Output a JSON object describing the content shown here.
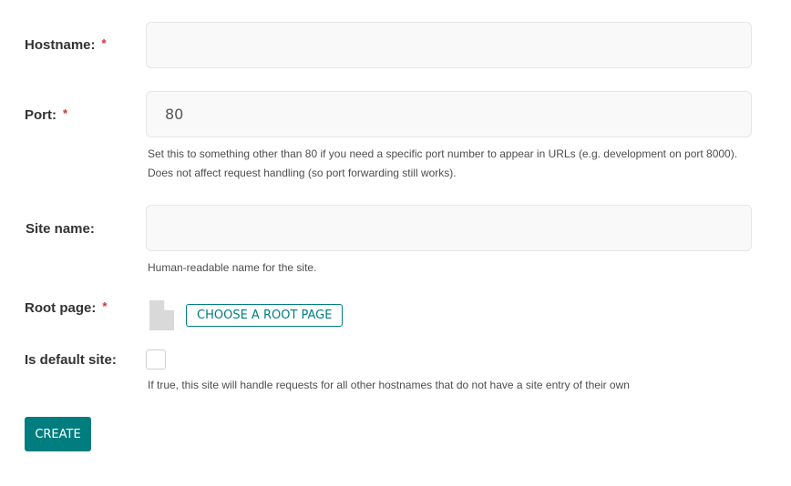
{
  "form": {
    "hostname": {
      "label": "Hostname:",
      "required_mark": "*",
      "value": ""
    },
    "port": {
      "label": "Port:",
      "required_mark": "*",
      "value": "80",
      "help": "Set this to something other than 80 if you need a specific port number to appear in URLs (e.g. development on port 8000). Does not affect request handling (so port forwarding still works)."
    },
    "site_name": {
      "label": "Site name:",
      "value": "",
      "help": "Human-readable name for the site."
    },
    "root_page": {
      "label": "Root page:",
      "required_mark": "*",
      "icon": "document-icon",
      "choose_label": "CHOOSE A ROOT PAGE"
    },
    "is_default_site": {
      "label": "Is default site:",
      "checked": false,
      "help": "If true, this site will handle requests for all other hostnames that do not have a site entry of their own"
    },
    "submit_label": "CREATE"
  },
  "colors": {
    "accent": "#007d7e",
    "required": "#cd3238",
    "field_background": "#f9f9f9",
    "field_border": "#e6e6e6"
  }
}
